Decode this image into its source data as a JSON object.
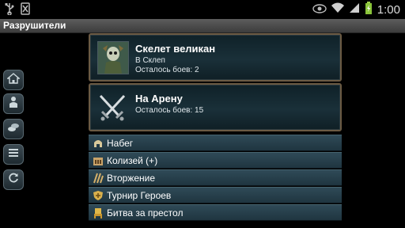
{
  "app": {
    "title": "Разрушители"
  },
  "statusbar": {
    "time": "1:00"
  },
  "cards": [
    {
      "title": "Скелет великан",
      "location": "В Склеп",
      "battles": "Осталось боев: 2"
    },
    {
      "title": "На Арену",
      "battles": "Осталось боев: 15"
    }
  ],
  "menu": [
    {
      "label": "Набег",
      "icon": "helmet-icon"
    },
    {
      "label": "Колизей (+)",
      "icon": "coliseum-icon"
    },
    {
      "label": "Вторжение",
      "icon": "invasion-icon"
    },
    {
      "label": "Турнир Героев",
      "icon": "shield-icon"
    },
    {
      "label": "Битва за престол",
      "icon": "throne-icon"
    }
  ],
  "sidebar": [
    {
      "icon": "home-icon"
    },
    {
      "icon": "character-icon"
    },
    {
      "icon": "coins-icon"
    },
    {
      "icon": "list-icon"
    },
    {
      "icon": "refresh-icon"
    }
  ]
}
